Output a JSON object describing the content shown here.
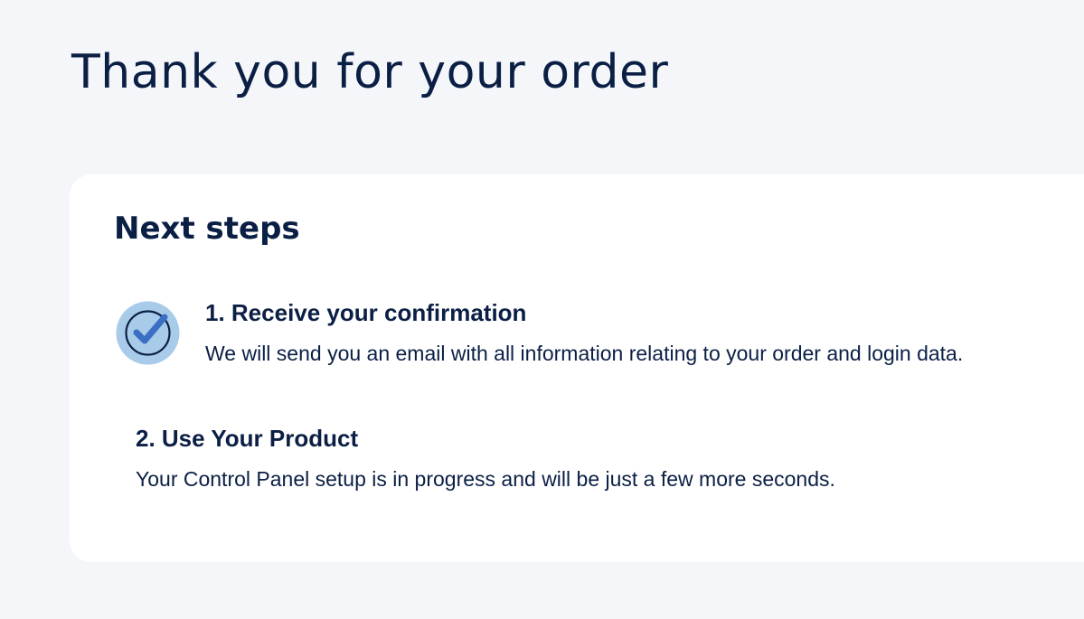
{
  "page": {
    "title": "Thank you for your order"
  },
  "next_steps": {
    "heading": "Next steps",
    "steps": [
      {
        "title": "1. Receive your confirmation",
        "description": "We will send you an email with all information relating to your order and login data.",
        "icon": "check-circle-icon"
      },
      {
        "title": "2. Use Your Product",
        "description": "Your Control Panel setup is in progress and will be just a few more seconds."
      }
    ]
  },
  "colors": {
    "background": "#f4f6fa",
    "card": "#ffffff",
    "text": "#0b1f45",
    "icon_fill": "#a8cbe9",
    "icon_check": "#3b6fc4"
  }
}
